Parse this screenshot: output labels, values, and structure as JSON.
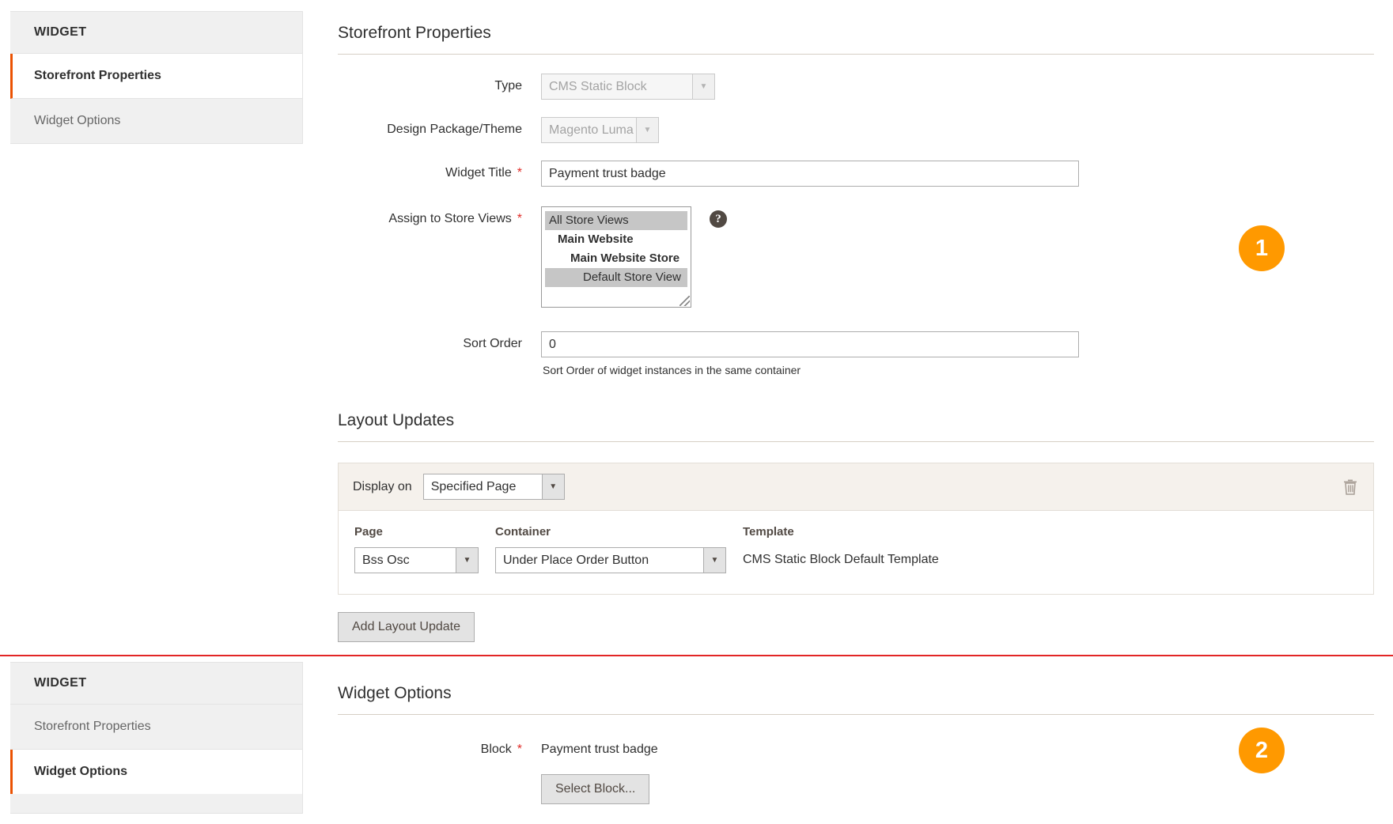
{
  "panel1": {
    "nav": {
      "title": "WIDGET",
      "items": [
        {
          "label": "Storefront Properties",
          "active": true
        },
        {
          "label": "Widget Options",
          "active": false
        }
      ]
    },
    "section_title": "Storefront Properties",
    "fields": {
      "type": {
        "label": "Type",
        "value": "CMS Static Block",
        "disabled": true
      },
      "design": {
        "label": "Design Package/Theme",
        "value": "Magento Luma",
        "disabled": true
      },
      "widget_title": {
        "label": "Widget Title",
        "value": "Payment trust badge",
        "required": true
      },
      "store_views": {
        "label": "Assign to Store Views",
        "required": true,
        "options": [
          {
            "text": "All Store Views",
            "level": 0,
            "selected": true
          },
          {
            "text": "Main Website",
            "level": 1,
            "selected": false
          },
          {
            "text": "Main Website Store",
            "level": 2,
            "selected": false
          },
          {
            "text": "Default Store View",
            "level": 3,
            "selected": true
          }
        ],
        "help_icon": "question-mark-icon"
      },
      "sort_order": {
        "label": "Sort Order",
        "value": "0",
        "note": "Sort Order of widget instances in the same container"
      }
    },
    "layout_updates": {
      "section_title": "Layout Updates",
      "display_on_label": "Display on",
      "display_on_value": "Specified Page",
      "delete_icon": "trash-icon",
      "columns": {
        "page": "Page",
        "container": "Container",
        "template": "Template"
      },
      "row": {
        "page": "Bss Osc",
        "container": "Under Place Order Button",
        "template": "CMS Static Block Default Template"
      },
      "add_button": "Add Layout Update"
    },
    "badge": "1"
  },
  "panel2": {
    "nav": {
      "title": "WIDGET",
      "items": [
        {
          "label": "Storefront Properties",
          "active": false
        },
        {
          "label": "Widget Options",
          "active": true
        }
      ]
    },
    "section_title": "Widget Options",
    "block": {
      "label": "Block",
      "required": true,
      "value": "Payment trust badge",
      "select_button": "Select Block..."
    },
    "badge": "2"
  },
  "colors": {
    "accent_orange": "#eb5202",
    "badge_orange": "#ff9900",
    "required_red": "#e02b27",
    "divider_red": "#e22626"
  }
}
